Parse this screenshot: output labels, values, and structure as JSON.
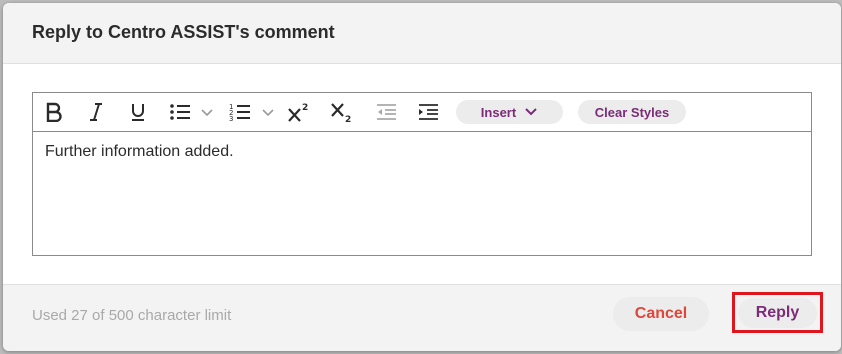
{
  "dialog": {
    "title": "Reply to Centro ASSIST's comment"
  },
  "toolbar": {
    "icons": [
      "bold-icon",
      "italic-icon",
      "underline-icon",
      "bullet-list-icon",
      "chevron-down-icon",
      "numbered-list-icon",
      "chevron-down-icon",
      "superscript-icon",
      "subscript-icon",
      "outdent-icon",
      "indent-icon"
    ],
    "insert_label": "Insert",
    "clear_styles_label": "Clear Styles"
  },
  "editor": {
    "content": "Further information added."
  },
  "footer": {
    "char_count": "Used 27 of 500 character limit",
    "cancel_label": "Cancel",
    "reply_label": "Reply"
  },
  "colors": {
    "accent": "#7b2c78",
    "cancel": "#e0463a",
    "highlight_border": "#e0161e",
    "muted_text": "#a9a9a9"
  }
}
